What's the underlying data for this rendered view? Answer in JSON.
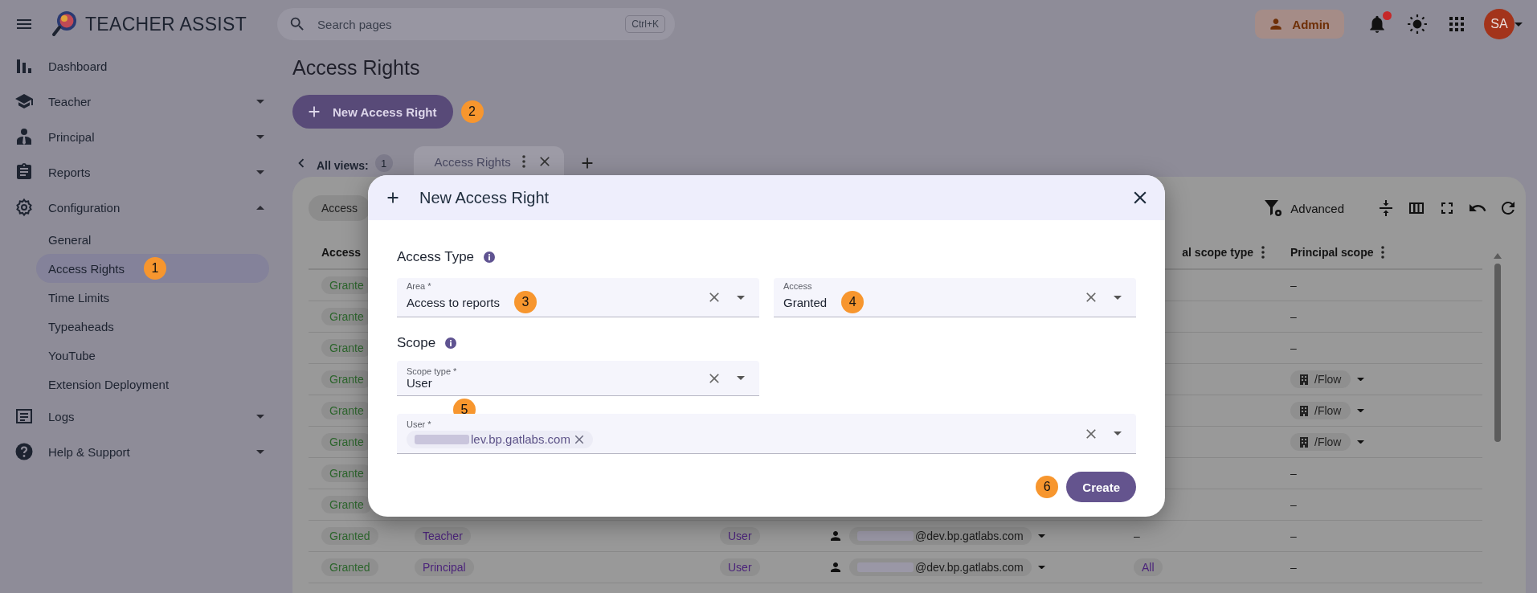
{
  "topbar": {
    "app_name": "TEACHER ASSIST",
    "search": {
      "placeholder": "Search pages",
      "shortcut": "Ctrl+K"
    },
    "role": "Admin",
    "notifications_unread": true,
    "avatar": "SA"
  },
  "sidebar": {
    "items": [
      {
        "kind": "link",
        "label": "Dashboard"
      },
      {
        "kind": "group",
        "label": "Teacher",
        "expanded": false
      },
      {
        "kind": "group",
        "label": "Principal",
        "expanded": false
      },
      {
        "kind": "group",
        "label": "Reports",
        "expanded": false
      },
      {
        "kind": "group",
        "label": "Configuration",
        "expanded": true,
        "children": [
          {
            "label": "General",
            "selected": false
          },
          {
            "label": "Access Rights",
            "selected": true,
            "callout": "1"
          },
          {
            "label": "Time Limits",
            "selected": false
          },
          {
            "label": "Typeaheads",
            "selected": false
          },
          {
            "label": "YouTube",
            "selected": false
          },
          {
            "label": "Extension Deployment",
            "selected": false
          }
        ]
      },
      {
        "kind": "group",
        "label": "Logs",
        "expanded": false
      },
      {
        "kind": "group",
        "label": "Help & Support",
        "expanded": false
      }
    ]
  },
  "page": {
    "title": "Access Rights",
    "new_button": {
      "label": "New Access Right",
      "callout": "2"
    },
    "views": {
      "label": "All views:",
      "count": "1",
      "tabs": [
        {
          "label": "Access Rights",
          "selected": true
        }
      ]
    },
    "toolbar": {
      "filter_chip": "Access",
      "advanced": "Advanced"
    },
    "table": {
      "column_1": "Access",
      "column_5": "al scope type",
      "principal_scope": "Principal scope",
      "rows": [
        {
          "access": "Grante",
          "principal_scope": {
            "kind": "dash",
            "text": "–"
          }
        },
        {
          "access": "Grante",
          "principal_scope": {
            "kind": "dash",
            "text": "–"
          }
        },
        {
          "access": "Grante",
          "principal_scope": {
            "kind": "dash",
            "text": "–"
          }
        },
        {
          "access": "Grante",
          "principal_scope": {
            "kind": "unit",
            "text": "/Flow"
          }
        },
        {
          "access": "Grante",
          "principal_scope": {
            "kind": "unit",
            "text": "/Flow"
          }
        },
        {
          "access": "Grante",
          "principal_scope": {
            "kind": "unit",
            "text": "/Flow"
          }
        },
        {
          "access": "Grante",
          "principal_scope": {
            "kind": "dash",
            "text": "–"
          }
        },
        {
          "access": "Grante",
          "principal_scope": {
            "kind": "dash",
            "text": "–"
          }
        },
        {
          "access": "Granted",
          "area": "Teacher",
          "scope_type": "User",
          "user": "@dev.bp.gatlabs.com",
          "principal_scope_type": {
            "kind": "dash",
            "text": "–"
          },
          "principal_scope": {
            "kind": "dash",
            "text": "–"
          }
        },
        {
          "access": "Granted",
          "area": "Principal",
          "scope_type": "User",
          "user": "@dev.bp.gatlabs.com",
          "principal_scope_type": {
            "kind": "chip",
            "text": "All"
          },
          "principal_scope": {
            "kind": "dash",
            "text": "–"
          }
        }
      ]
    }
  },
  "dialog": {
    "title": "New Access Right",
    "sections": [
      {
        "heading": "Access Type",
        "fields": [
          {
            "kind": "select",
            "label": "Area *",
            "value": "Access to reports",
            "callout": "3"
          },
          {
            "kind": "select",
            "label": "Access",
            "value": "Granted",
            "callout": "4"
          }
        ]
      },
      {
        "heading": "Scope",
        "fields": [
          {
            "kind": "select",
            "label": "Scope type *",
            "value": "User",
            "callout": "5"
          },
          {
            "kind": "multi",
            "label": "User *",
            "chips": [
              "lev.bp.gatlabs.com"
            ]
          }
        ]
      }
    ],
    "submit": {
      "label": "Create",
      "callout": "6"
    }
  }
}
